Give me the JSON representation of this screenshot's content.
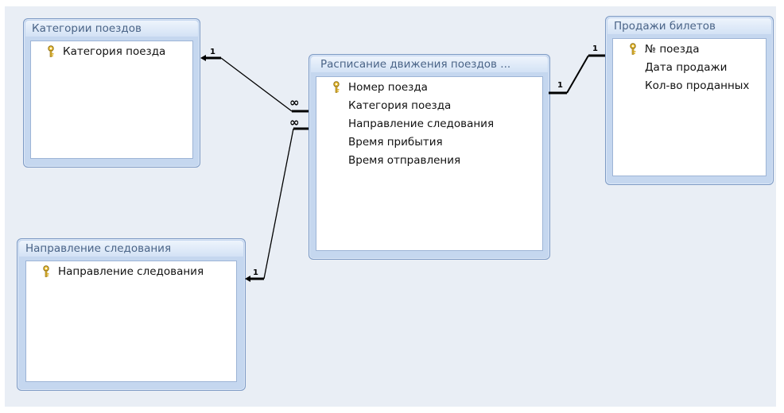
{
  "tables": {
    "kategorii": {
      "title": "Категории поездов",
      "fields": [
        {
          "name": "Категория поезда",
          "key": true
        }
      ]
    },
    "napravlenie": {
      "title": "Направление следования",
      "fields": [
        {
          "name": "Направление следования",
          "key": true
        }
      ]
    },
    "raspisanie": {
      "title": "Расписание движения поездов ...",
      "fields": [
        {
          "name": "Номер поезда",
          "key": true
        },
        {
          "name": "Категория поезда",
          "key": false
        },
        {
          "name": "Направление следования",
          "key": false
        },
        {
          "name": "Время прибытия",
          "key": false
        },
        {
          "name": "Время отправления",
          "key": false
        }
      ]
    },
    "prodazhi": {
      "title": "Продажи билетов",
      "fields": [
        {
          "name": "№ поезда",
          "key": true
        },
        {
          "name": "Дата продажи",
          "key": false
        },
        {
          "name": "Кол-во проданных",
          "key": false
        }
      ]
    }
  },
  "relations": {
    "one_label": "1",
    "many_label": "∞"
  },
  "icons": {
    "primary_key": "key-icon"
  },
  "colors": {
    "canvas": "#e9eef5",
    "border": "#7d9ac4",
    "header_text": "#4a6487"
  }
}
